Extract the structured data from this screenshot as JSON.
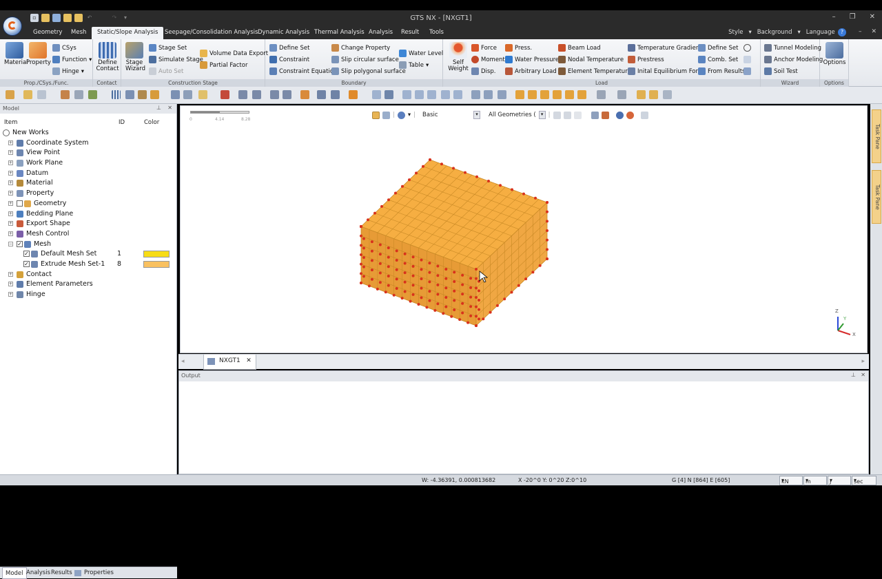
{
  "window": {
    "title": "GTS NX - [NXGT1]"
  },
  "ribbon_tabs": [
    "Geometry",
    "Mesh",
    "Static/Slope Analysis",
    "Seepage/Consolidation Analysis",
    "Dynamic Analysis",
    "Thermal Analysis",
    "Analysis",
    "Result",
    "Tools"
  ],
  "ribbon_right": {
    "style": "Style",
    "background": "Background",
    "language": "Language"
  },
  "groups": {
    "prop": {
      "label": "Prop./CSys./Func.",
      "material": "Material",
      "property": "Property",
      "csys": "CSys",
      "function": "Function",
      "hinge": "Hinge"
    },
    "contact": {
      "label": "Contact",
      "define_contact": "Define Contact"
    },
    "stage": {
      "label": "Construction Stage",
      "stage_wizard": "Stage Wizard",
      "stage_set": "Stage Set",
      "simulate_stage": "Simulate Stage",
      "auto_set": "Auto Set",
      "volume_data_export": "Volume Data Export",
      "partial_factor": "Partial Factor"
    },
    "boundary": {
      "label": "Boundary",
      "define_set": "Define Set",
      "constraint": "Constraint",
      "constraint_equation": "Constraint Equation",
      "change_property": "Change Property",
      "slip_circular": "Slip circular surface",
      "slip_polygonal": "Slip polygonal surface",
      "water_level": "Water Level",
      "table": "Table"
    },
    "load": {
      "label": "Load",
      "self_weight": "Self Weight",
      "force": "Force",
      "moment": "Moment",
      "disp": "Disp.",
      "press": "Press.",
      "water_pressure": "Water Pressure",
      "arbitrary_load": "Arbitrary Load",
      "beam_load": "Beam Load",
      "nodal_temperature": "Nodal Temperature",
      "element_temperature": "Element Temperature",
      "temperature_gradient": "Temperature Gradient",
      "prestress": "Prestress",
      "initial_equilibrium": "Inital Equilibrium Force",
      "define_set": "Define Set",
      "comb_set": "Comb. Set",
      "from_results": "From Results"
    },
    "wizard": {
      "label": "Wizard",
      "tunnel_modeling": "Tunnel Modeling",
      "anchor_modeling": "Anchor Modeling",
      "soil_test": "Soil Test"
    },
    "options": {
      "label": "Options",
      "options": "Options"
    }
  },
  "model_panel": {
    "title": "Model",
    "columns": {
      "item": "Item",
      "id": "ID",
      "color": "Color"
    },
    "tree": [
      {
        "label": "New Works",
        "level": 0
      },
      {
        "label": "Coordinate System",
        "level": 1
      },
      {
        "label": "View Point",
        "level": 1
      },
      {
        "label": "Work Plane",
        "level": 1
      },
      {
        "label": "Datum",
        "level": 1
      },
      {
        "label": "Material",
        "level": 1
      },
      {
        "label": "Property",
        "level": 1
      },
      {
        "label": "Geometry",
        "level": 1
      },
      {
        "label": "Bedding Plane",
        "level": 1
      },
      {
        "label": "Export Shape",
        "level": 1
      },
      {
        "label": "Mesh Control",
        "level": 1
      },
      {
        "label": "Mesh",
        "level": 1
      },
      {
        "label": "Default Mesh Set",
        "level": 2,
        "id": "1",
        "color": "#f7dc16"
      },
      {
        "label": "Extrude Mesh Set-1",
        "level": 2,
        "id": "8",
        "color": "#f9c160"
      },
      {
        "label": "Contact",
        "level": 1
      },
      {
        "label": "Element Parameters",
        "level": 1
      },
      {
        "label": "Hinge",
        "level": 1
      }
    ],
    "bottom_tabs": [
      "Model",
      "Analysis",
      "Results",
      "Properties"
    ]
  },
  "viewport": {
    "render_mode": "Basic",
    "filter": "All Geometries (",
    "scale": [
      "0",
      "4.14",
      "8.28"
    ],
    "axes": {
      "z": "Z",
      "y": "Y",
      "x": "X"
    },
    "model_color": "#f6ae42",
    "grid_color": "#c98a26",
    "constraint_color": "#d8321c"
  },
  "doc_tab": {
    "label": "NXGT1"
  },
  "output": {
    "title": "Output"
  },
  "right_tabs": [
    "Task Pane",
    "Task Pane"
  ],
  "status": {
    "coords_w": "W: -4.36391, 0.000813682",
    "coords_xyz": "X -20^0 Y: 0^20 Z:0^10",
    "counts": "G [4] N [864] E [605]",
    "units": [
      "kN",
      "m",
      "J",
      "sec"
    ]
  }
}
